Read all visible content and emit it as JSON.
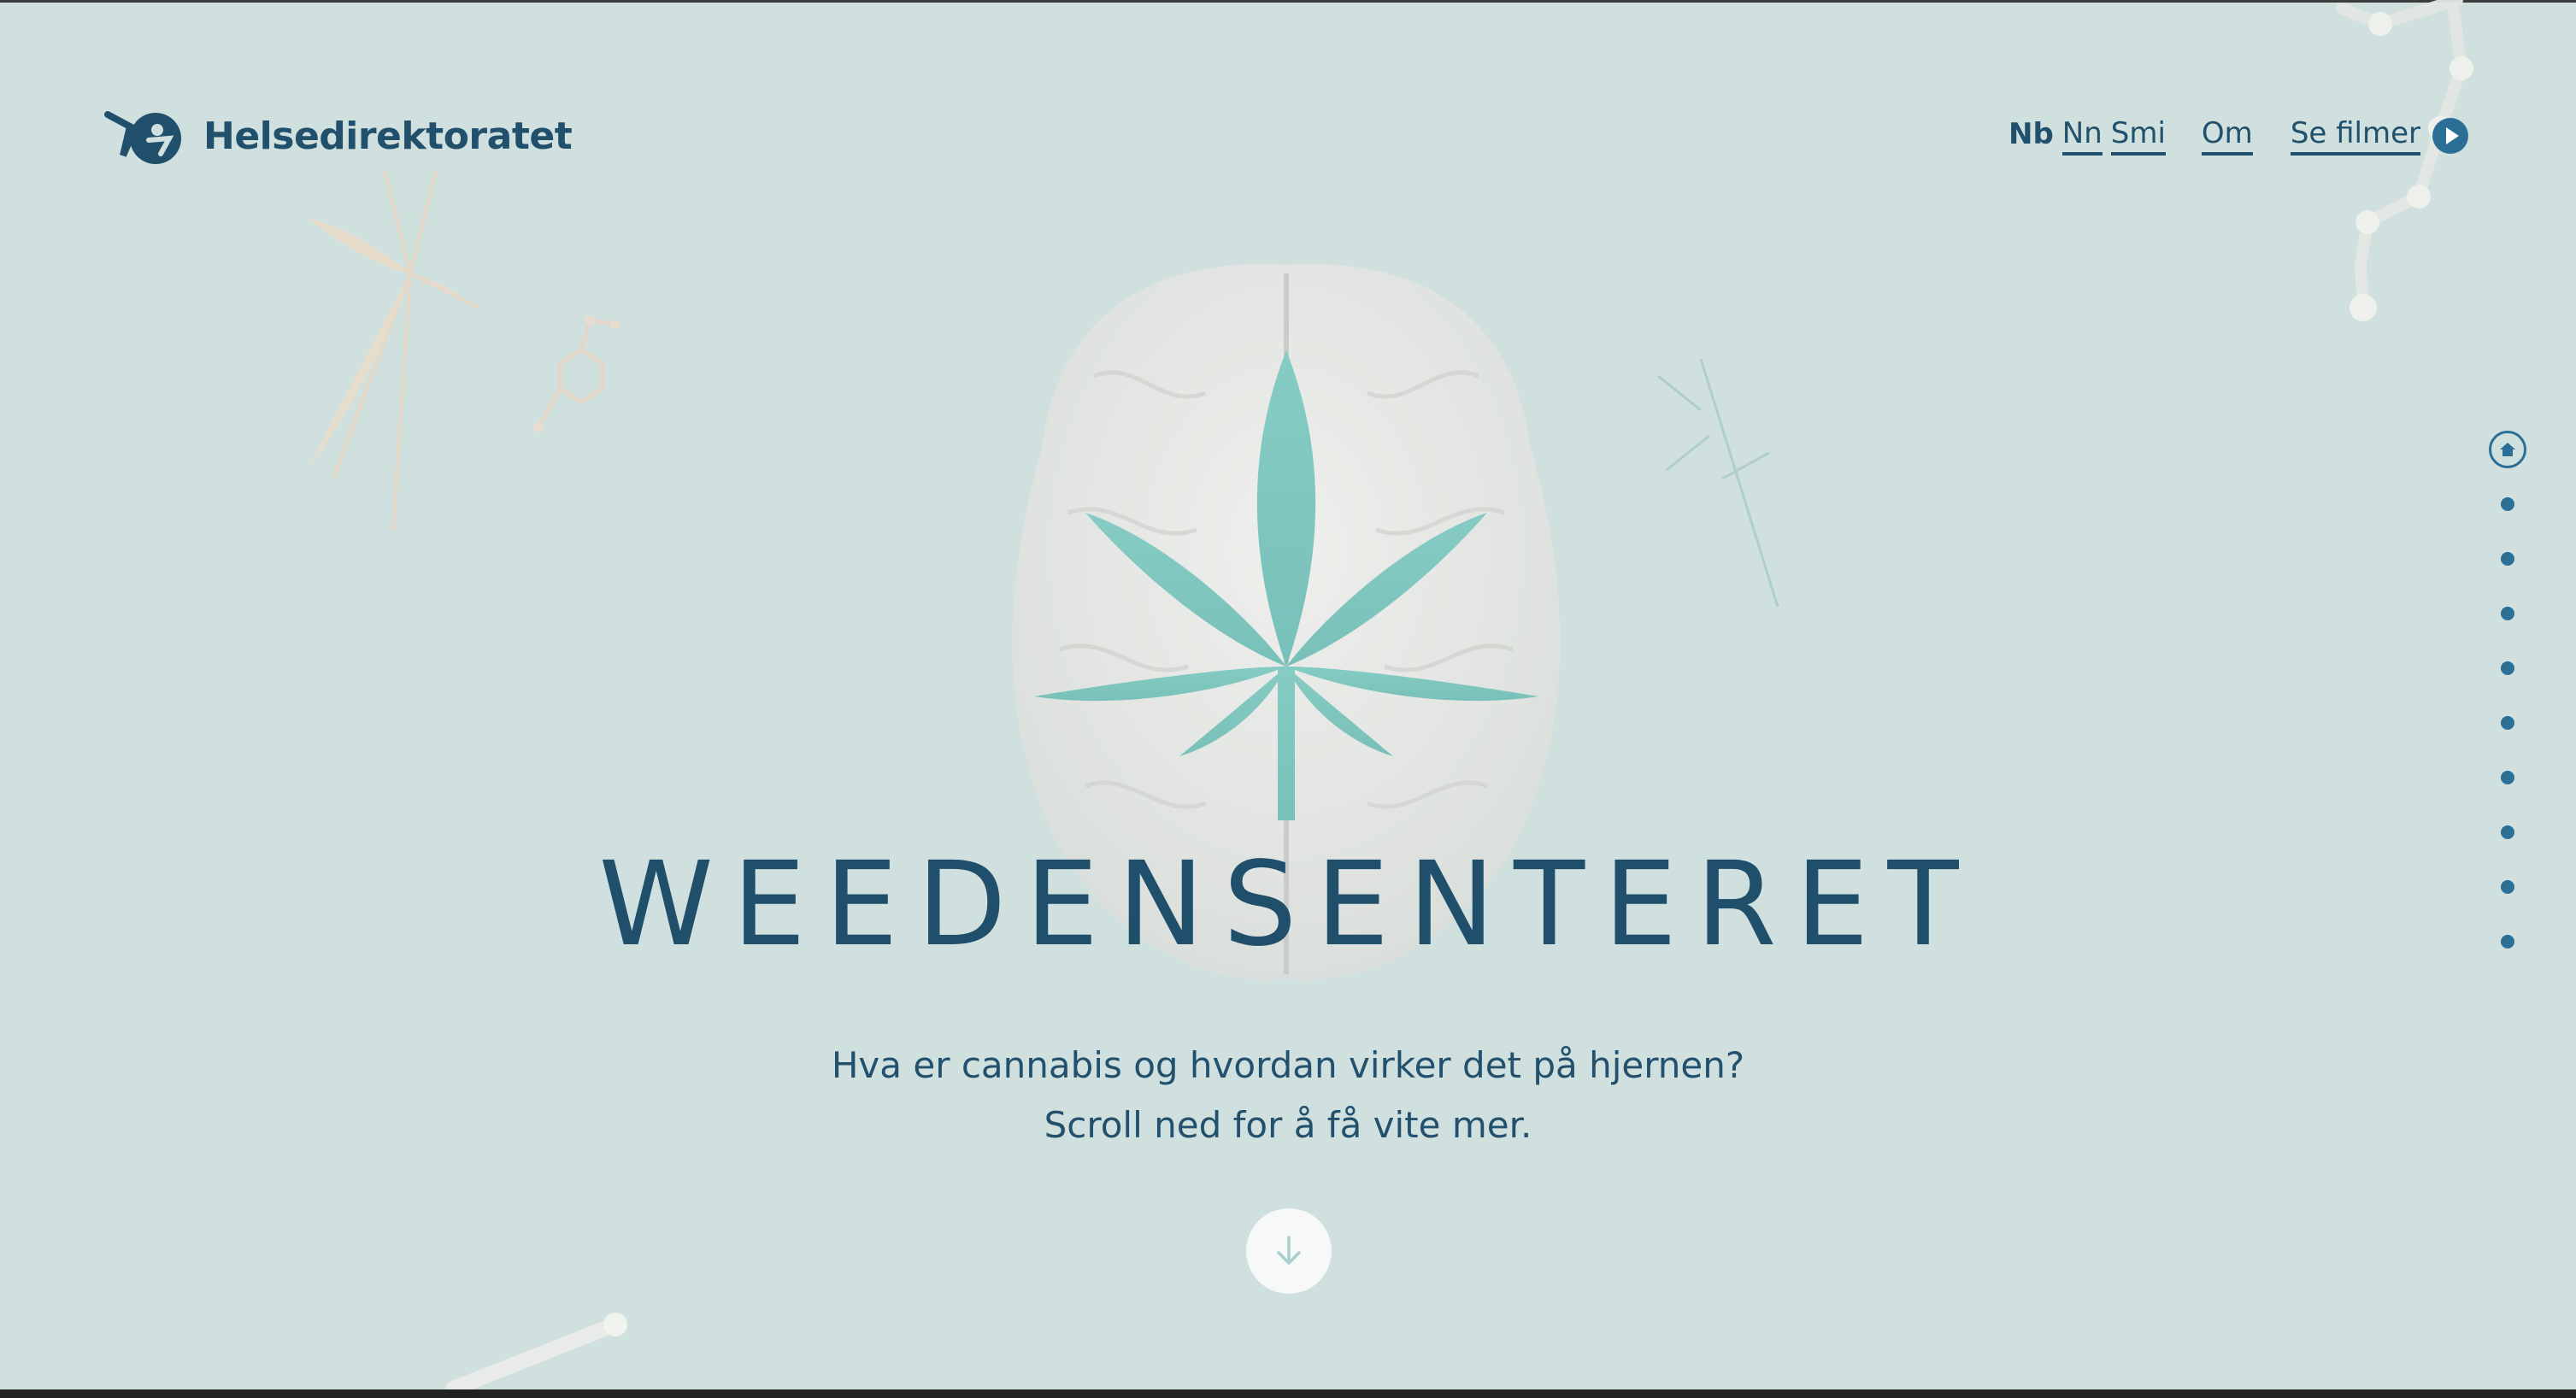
{
  "header": {
    "logo_text": "Helsedirektoratet",
    "languages": [
      {
        "label": "Nb",
        "active": true
      },
      {
        "label": "Nn",
        "active": false
      },
      {
        "label": "Smi",
        "active": false
      }
    ],
    "about_label": "Om",
    "films_label": "Se filmer",
    "films_icon": "play-icon"
  },
  "hero": {
    "title": "WEEDENSENTERET",
    "subtitle_line1": "Hva er cannabis og hvordan virker det på hjernen?",
    "subtitle_line2": "Scroll ned for å få vite mer.",
    "scroll_icon": "arrow-down-icon"
  },
  "sidenav": {
    "home_icon": "home-icon",
    "section_count": 9
  },
  "colors": {
    "background": "#cfe0df",
    "primary": "#1f4f6b",
    "accent": "#2b6f97",
    "leaf": "#7fc6bf"
  }
}
